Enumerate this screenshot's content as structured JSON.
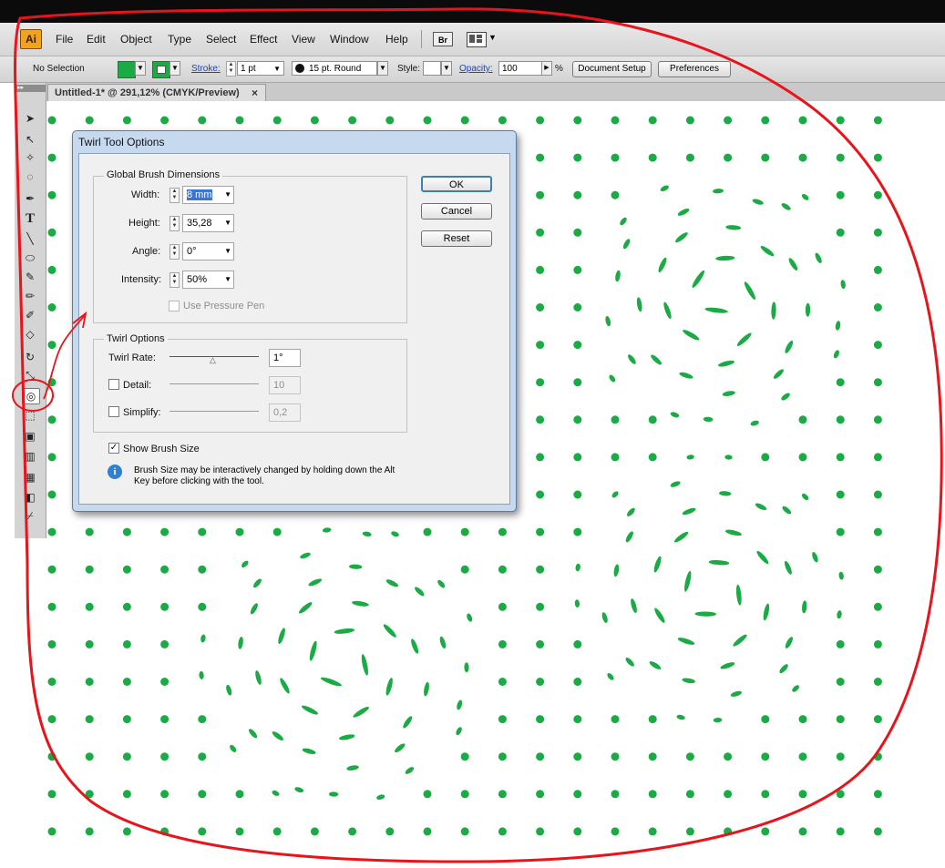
{
  "app": {
    "logo_text": "Ai",
    "menu": [
      "File",
      "Edit",
      "Object",
      "Type",
      "Select",
      "Effect",
      "View",
      "Window",
      "Help"
    ],
    "bridge_label": "Br"
  },
  "control_bar": {
    "selection": "No Selection",
    "stroke_label": "Stroke:",
    "stroke_value": "1 pt",
    "brush_value": "15 pt. Round",
    "style_label": "Style:",
    "opacity_label": "Opacity:",
    "opacity_value": "100",
    "percent": "%",
    "document_setup": "Document Setup",
    "preferences": "Preferences",
    "fill_color": "#1aab45"
  },
  "document_tab": {
    "title": "Untitled-1* @ 291,12% (CMYK/Preview)",
    "close": "×"
  },
  "dialog": {
    "title": "Twirl Tool Options",
    "brush_group": "Global Brush Dimensions",
    "width_label": "Width:",
    "width_value": "8 mm",
    "height_label": "Height:",
    "height_value": "35,28",
    "angle_label": "Angle:",
    "angle_value": "0°",
    "intensity_label": "Intensity:",
    "intensity_value": "50%",
    "pressure_label": "Use Pressure Pen",
    "twirl_group": "Twirl Options",
    "twirl_rate_label": "Twirl Rate:",
    "twirl_rate_value": "1°",
    "detail_label": "Detail:",
    "detail_value": "10",
    "simplify_label": "Simplify:",
    "simplify_value": "0,2",
    "show_brush_label": "Show Brush Size",
    "show_brush_checked": true,
    "info_text": "Brush Size may be interactively changed by holding down the Alt Key before clicking with the tool.",
    "ok": "OK",
    "cancel": "Cancel",
    "reset": "Reset"
  },
  "canvas": {
    "dot_color": "#1aab45",
    "annotation_color": "#e8141b"
  }
}
